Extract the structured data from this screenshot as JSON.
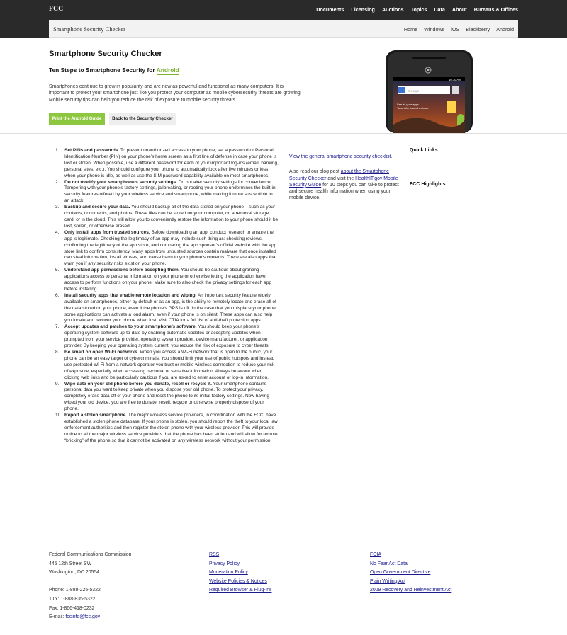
{
  "header": {
    "logo": "FCC",
    "nav": [
      "Documents",
      "Licensing",
      "Auctions",
      "Topics",
      "Data",
      "About",
      "Bureaus & Offices"
    ]
  },
  "subheader": {
    "title": "Smartphone Security Checker",
    "nav": [
      "Home",
      "Windows",
      "iOS",
      "Blackberry",
      "Android"
    ]
  },
  "hero": {
    "title": "Smartphone Security Checker",
    "subtitle_prefix": "Ten Steps to Smartphone Security for ",
    "subtitle_platform": "Android",
    "intro": "Smartphones continue to grow in popularity and are now as powerful and functional as many computers. It is important to protect your smartphone just like you protect your computer as mobile cybersecurity threats are growing. Mobile security tips can help you reduce the risk of exposure to mobile security threats.",
    "print_button": "Print the Android Guide",
    "back_button": "Back to the Security Checker",
    "phone_time": "10:10 AM",
    "phone_search": "Google",
    "phone_hint_line1": "See all your apps.",
    "phone_hint_line2": "Touch the Launcher icon."
  },
  "steps": [
    {
      "num": "1.",
      "title": "Set PINs and passwords.",
      "text": " To prevent unauthorized access to your phone, set a password or Personal Identification Number (PIN) on your phone’s home screen as a first line of defense in case your phone is lost or stolen. When possible, use a different password for each of your important log-ins (email, banking, personal sites, etc.). You should configure your phone to automatically lock after five minutes or less when your phone is idle, as well as use the SIM password capability available on most smartphones."
    },
    {
      "num": "2.",
      "title": "Do not modify your smartphone’s security settings.",
      "text": " Do not alter security settings for convenience. Tampering with your phone’s factory settings, jailbreaking, or rooting your phone undermines the built-in security features offered by your wireless service and smartphone, while making it more susceptible to an attack."
    },
    {
      "num": "3.",
      "title": "Backup and secure your data.",
      "text": " You should backup all of the data stored on your phone – such as your contacts, documents, and photos. These files can be stored on your computer, on a removal storage card, or in the cloud. This will allow you to conveniently restore the information to your phone should it be lost, stolen, or otherwise erased."
    },
    {
      "num": "4.",
      "title": "Only install apps from trusted sources.",
      "text": " Before downloading an app, conduct research to ensure the app is legitimate. Checking the legitimacy of an app may include such thing as: checking reviews, confirming the legitimacy of the app store, and comparing the app sponsor’s official website with the app store link to confirm consistency. Many apps from untrusted sources contain malware that once installed can steal information, install viruses, and cause harm to your phone’s contents. There are also apps that warn you if any security risks exist on your phone."
    },
    {
      "num": "5.",
      "title": "Understand app permissions before accepting them.",
      "text": " You should be cautious about granting applications access to personal information on your phone or otherwise letting the application have access to perform functions on your phone. Make sure to also check the privacy settings for each app before installing."
    },
    {
      "num": "6.",
      "title": "Install security apps that enable remote location and wiping.",
      "text": " An important security feature widely available on smartphones, either by default or as an app, is the ability to remotely locate and erase all of the data stored on your phone, even if the phone’s GPS is off. In the case that you misplace your phone, some applications can activate a loud alarm, even if your phone is on silent. These apps can also help you locate and recover your phone when lost. Visit CTIA for a full list of anti-theft protection apps."
    },
    {
      "num": "7.",
      "title": "Accept updates and patches to your smartphone’s software.",
      "text": " You should keep your phone’s operating system software up-to-date by enabling automatic updates or accepting updates when prompted from your service provider, operating system provider, device manufacturer, or application provider. By keeping your operating system current, you reduce the risk of exposure to cyber threats."
    },
    {
      "num": "8.",
      "title": "Be smart on open Wi-Fi networks.",
      "text": " When you access a Wi-Fi network that is open to the public, your phone can be an easy target of cybercriminals. You should limit your use of public hotspots and instead use protected Wi-Fi from a network operator you trust or mobile wireless connection to reduce your risk of exposure, especially when accessing personal or sensitive information. Always be aware when clicking web links and be particularly cautious if you are asked to enter account or log-in information."
    },
    {
      "num": "9.",
      "title": "Wipe data on your old phone before you donate, resell or recycle it.",
      "text": " Your smartphone contains personal data you want to keep private when you dispose your old phone. To protect your privacy, completely erase data off of your phone and reset the phone to its initial factory settings. Now having wiped your old device, you are free to donate, resell, recycle or otherwise properly dispose of your phone."
    },
    {
      "num": "10.",
      "title": "Report a stolen smartphone.",
      "text": " The major wireless service providers, in coordination with the FCC, have established a stolen phone database. If your phone is stolen, you should report the theft to your local law enforcement authorities and then register the stolen phone with your wireless provider. This will provide notice to all the major wireless service providers that the phone has been stolen and will allow for remote “bricking” of the phone so that it cannot be activated on any wireless network without your permission."
    }
  ],
  "middle": {
    "general_link": "View the general smartphone security checklist.",
    "blog_text_1": "Also read our blog post ",
    "blog_link": "about the Smartphone Security Checker",
    "blog_text_2": " and visit the ",
    "health_link": "HealthIT.gov Mobile Security Guide",
    "blog_text_3": " for 10 steps you can take to protect and secure health information when using your mobile device."
  },
  "sidebar": {
    "quick_links": "Quick Links",
    "highlights": "FCC Highlights"
  },
  "footer": {
    "org": "Federal Communications Commission",
    "address1": "445 12th Street SW",
    "address2": "Washington, DC 20554",
    "phone": "Phone: 1-888-225-5322",
    "tty": "TTY: 1-888-835-5322",
    "fax": "Fax: 1-866-418-0232",
    "email_label": "E-mail: ",
    "email": "fccinfo@fcc.gov",
    "links_col1": [
      "RSS",
      "Privacy Policy",
      "Moderation Policy",
      "Website Policies & Notices",
      "Required Browser & Plug-ins"
    ],
    "links_col2": [
      "FOIA",
      "No Fear Act Data",
      "Open Government Directive",
      "Plain Writing Act",
      "2009 Recovery and Reinvestment Act"
    ]
  }
}
